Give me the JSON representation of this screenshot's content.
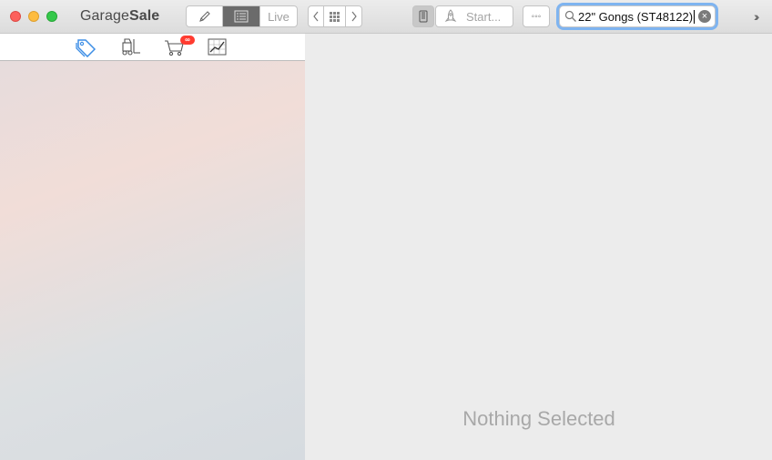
{
  "window": {
    "app_title_regular": "Garage",
    "app_title_bold": "Sale"
  },
  "toolbar": {
    "mode_segments": [
      {
        "icon": "pencil-icon"
      },
      {
        "icon": "list-view-icon",
        "selected": true
      },
      {
        "label": "Live"
      }
    ],
    "nav_segments": [
      {
        "icon": "chevron-left-icon"
      },
      {
        "icon": "grid-icon"
      },
      {
        "icon": "chevron-right-icon"
      }
    ],
    "device_icon": "phone-icon",
    "start_button": {
      "icon": "rocket-icon",
      "label": "Start..."
    },
    "more_button": {
      "label": "◦◦◦"
    },
    "search": {
      "value": "22\" Gongs (ST48122)",
      "icon": "search-icon"
    },
    "overflow_label": "››"
  },
  "left_tabs": [
    {
      "icon": "price-tag-icon",
      "selected": true
    },
    {
      "icon": "forklift-icon"
    },
    {
      "icon": "shopping-cart-icon",
      "badge": "∞"
    },
    {
      "icon": "chart-icon"
    }
  ],
  "detail": {
    "empty_message": "Nothing Selected"
  },
  "colors": {
    "accent": "#3d8ee6",
    "badge": "#ff3b30",
    "search_focus": "#7fb4f0"
  }
}
